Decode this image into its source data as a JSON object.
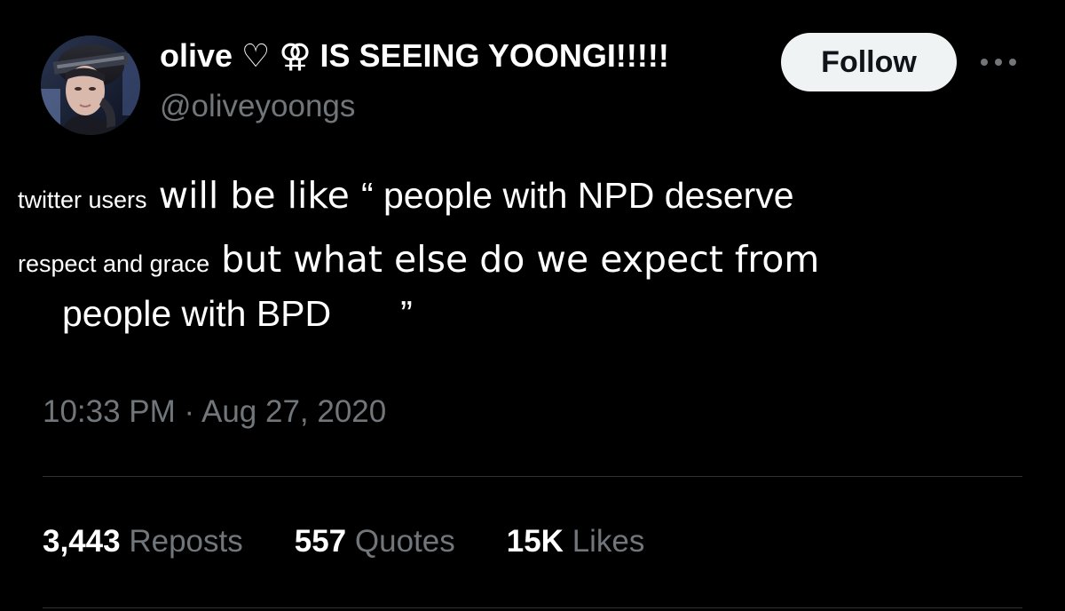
{
  "user": {
    "display_name": "olive ♡ ⚢ IS SEEING YOONGI!!!!!",
    "handle": "@oliveyoongs"
  },
  "follow_label": "Follow",
  "more_icon": "more-horizontal-icon",
  "tweet": {
    "line1_small": "twitter users",
    "line1_large_a": " will be like ",
    "line1_large_b": "“ people with NPD deserve",
    "line2_small": "respect and grace",
    "line2_large": " but what else do we expect from",
    "line3_text": "people with BPD",
    "line3_quote": "”"
  },
  "timestamp": "10:33 PM · Aug 27, 2020",
  "stats": [
    {
      "count": "3,443",
      "label": "Reposts"
    },
    {
      "count": "557",
      "label": "Quotes"
    },
    {
      "count": "15K",
      "label": "Likes"
    }
  ],
  "colors": {
    "background": "#000000",
    "text": "#ffffff",
    "secondary_text": "#71767b",
    "divider": "#2f3336",
    "follow_bg": "#eff3f4"
  }
}
